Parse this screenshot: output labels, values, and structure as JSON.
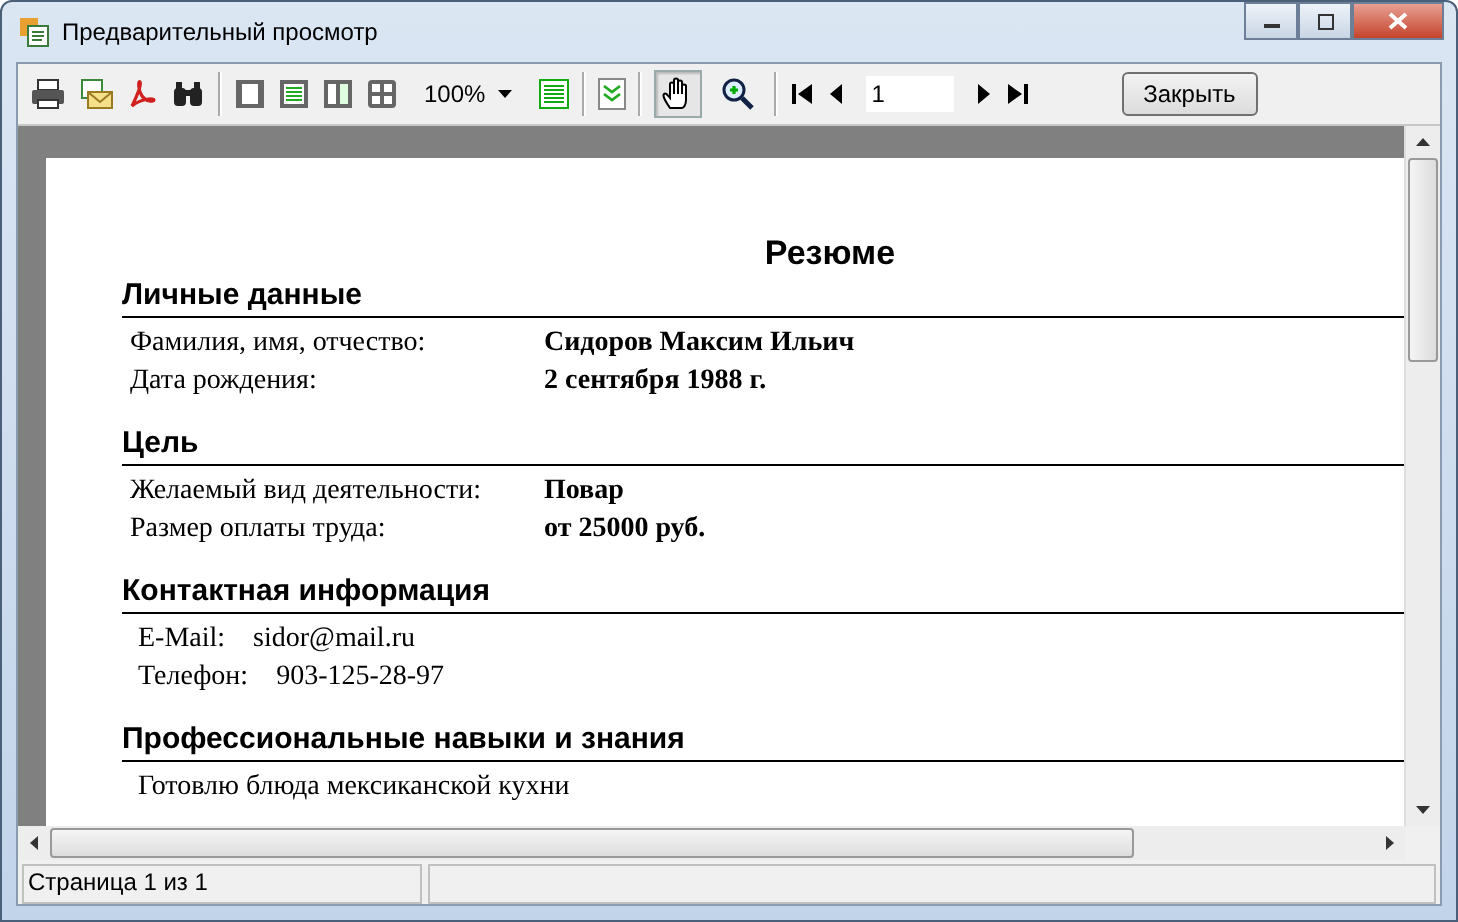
{
  "window": {
    "title": "Предварительный просмотр"
  },
  "toolbar": {
    "zoom": "100%",
    "tools": [
      {
        "kind": "hand",
        "selected": true
      },
      {
        "kind": "magnifier",
        "selected": false
      }
    ],
    "page": "1",
    "close": "Закрыть"
  },
  "document": {
    "title": "Резюме",
    "sections": [
      {
        "heading": "Личные данные",
        "rows": [
          {
            "kind": "pair",
            "label": "Фамилия, имя, отчество:",
            "value": "Сидоров Максим Ильич"
          },
          {
            "kind": "pair",
            "label": "Дата рождения:",
            "value": "2 сентября 1988 г."
          }
        ]
      },
      {
        "heading": "Цель",
        "rows": [
          {
            "kind": "pair",
            "label": "Желаемый вид деятельности:",
            "value": "Повар"
          },
          {
            "kind": "pair",
            "label": "Размер оплаты труда:",
            "value": "от 25000 руб."
          }
        ]
      },
      {
        "heading": "Контактная информация",
        "rows": [
          {
            "kind": "contact",
            "label": "E-Mail:",
            "value": "sidor@mail.ru"
          },
          {
            "kind": "contact",
            "label": "Телефон:",
            "value": "903-125-28-97"
          }
        ]
      },
      {
        "heading": "Профессиональные навыки и знания",
        "rows": [
          {
            "kind": "text",
            "value": "Готовлю блюда мексиканской кухни"
          }
        ]
      }
    ]
  },
  "status_bar": {
    "page": "Страница 1 из 1"
  }
}
